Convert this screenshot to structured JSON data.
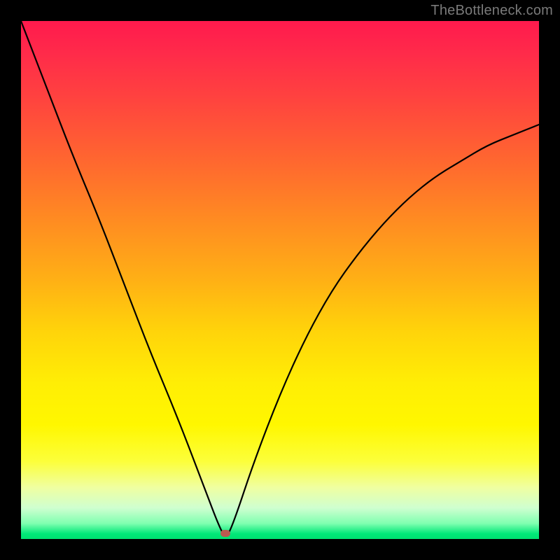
{
  "watermark": "TheBottleneck.com",
  "marker": {
    "x_pct": 39.5,
    "y_pct": 98.9,
    "color": "#bb5a50"
  },
  "colors": {
    "gradient_top": "#ff1a4d",
    "gradient_bottom": "#00e070",
    "curve": "#000000",
    "frame": "#000000"
  },
  "chart_data": {
    "type": "line",
    "title": "",
    "xlabel": "",
    "ylabel": "",
    "xlim": [
      0,
      100
    ],
    "ylim": [
      0,
      100
    ],
    "grid": false,
    "legend": false,
    "annotations": [
      {
        "text": "TheBottleneck.com",
        "position": "top-right"
      }
    ],
    "series": [
      {
        "name": "bottleneck-curve",
        "x": [
          0,
          5,
          10,
          15,
          20,
          25,
          30,
          35,
          38,
          39.5,
          41,
          45,
          50,
          55,
          60,
          65,
          70,
          75,
          80,
          85,
          90,
          95,
          100
        ],
        "y": [
          100,
          87,
          74,
          62,
          49,
          36,
          24,
          11,
          3,
          0,
          3,
          15,
          28,
          39,
          48,
          55,
          61,
          66,
          70,
          73,
          76,
          78,
          80
        ]
      }
    ],
    "marker_point": {
      "x": 39.5,
      "y": 0
    }
  }
}
